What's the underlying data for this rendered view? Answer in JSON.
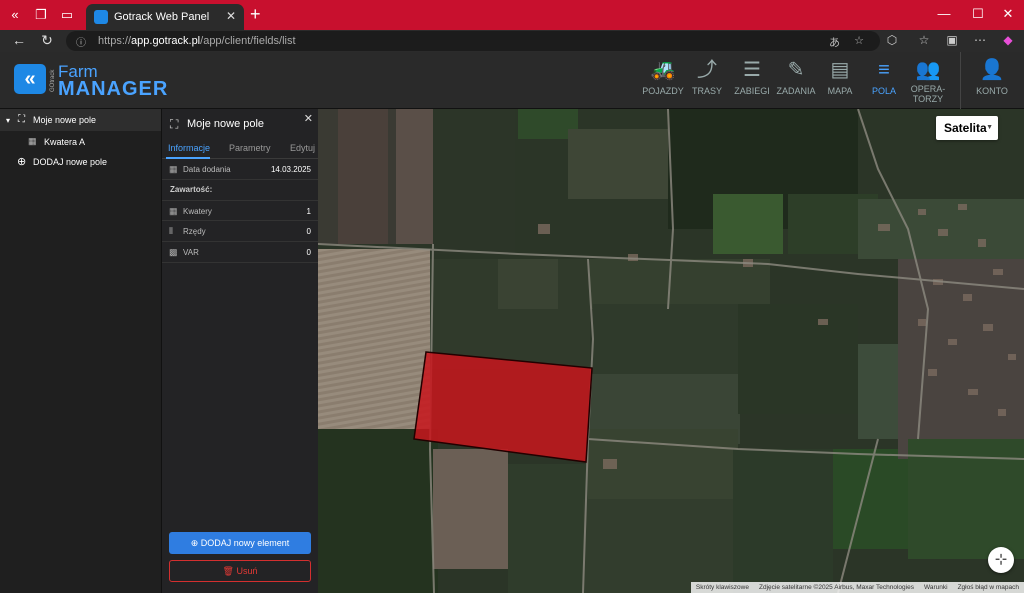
{
  "browser": {
    "tab_title": "Gotrack Web Panel",
    "url_host": "app.gotrack.pl",
    "url_prefix": "https://",
    "url_path": "/app/client/fields/list"
  },
  "header": {
    "logo_small": "GOtrack",
    "logo_line1": "Farm",
    "logo_line2": "MANAGER",
    "nav": [
      {
        "label": "POJAZDY",
        "icon": "tractor-icon"
      },
      {
        "label": "TRASY",
        "icon": "route-icon"
      },
      {
        "label": "ZABIEGI",
        "icon": "list-icon"
      },
      {
        "label": "ZADANIA",
        "icon": "task-icon"
      },
      {
        "label": "MAPA",
        "icon": "map-icon"
      },
      {
        "label": "POLA",
        "icon": "fields-icon",
        "active": true
      },
      {
        "label": "OPERA-TORZY",
        "label_line1": "OPERA-",
        "label_line2": "TORZY",
        "icon": "operators-icon"
      },
      {
        "label": "KONTO",
        "icon": "account-icon"
      }
    ]
  },
  "tree": {
    "field_name": "Moje nowe pole",
    "child_name": "Kwatera A",
    "add_label": "DODAJ nowe pole"
  },
  "details": {
    "title": "Moje nowe pole",
    "tabs": [
      "Informacje",
      "Parametry",
      "Edytuj"
    ],
    "date_label": "Data dodania",
    "date_value": "14.03.2025",
    "section_label": "Zawartość:",
    "rows": [
      {
        "label": "Kwatery",
        "value": "1"
      },
      {
        "label": "Rzędy",
        "value": "0"
      },
      {
        "label": "VAR",
        "value": "0"
      }
    ],
    "add_element_label": "DODAJ nowy element",
    "delete_label": "Usuń"
  },
  "map": {
    "type_label": "Satelita",
    "field_color": "#c8161d",
    "attribution": [
      "Skróty klawiszowe",
      "Zdjęcie satelitarne ©2025 Airbus, Maxar Technologies",
      "Warunki",
      "Zgłoś błąd w mapach"
    ]
  }
}
